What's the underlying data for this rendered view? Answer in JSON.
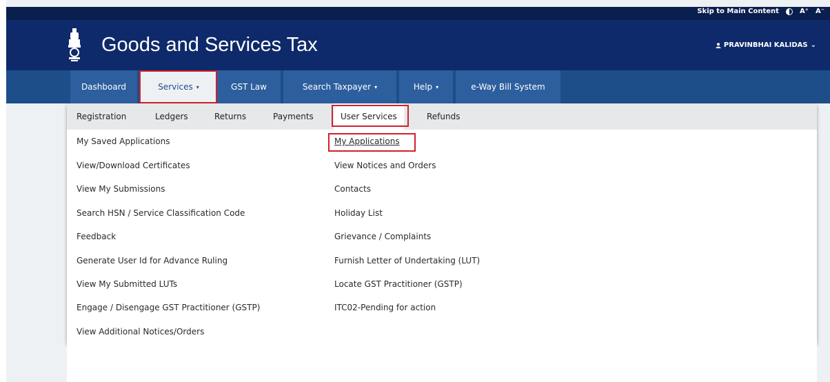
{
  "top_bar": {
    "skip_link": "Skip to Main Content",
    "font_increase": "A⁺",
    "font_decrease": "A⁻"
  },
  "header": {
    "title": "Goods and Services Tax",
    "user_name": "PRAVINBHAI KALIDAS",
    "user_caret": "⌄"
  },
  "nav": {
    "dashboard": "Dashboard",
    "services": "Services",
    "gst_law": "GST Law",
    "search_taxpayer": "Search Taxpayer",
    "help": "Help",
    "eway": "e-Way Bill System",
    "caret": "▾"
  },
  "subnav": {
    "registration": "Registration",
    "ledgers": "Ledgers",
    "returns": "Returns",
    "payments": "Payments",
    "user_services": "User Services",
    "refunds": "Refunds"
  },
  "menu": {
    "left": [
      "My Saved Applications",
      "View/Download Certificates",
      "View My Submissions",
      "Search HSN / Service Classification Code",
      "Feedback",
      "Generate User Id for Advance Ruling",
      "View My Submitted LUTs",
      "Engage / Disengage GST Practitioner (GSTP)",
      "View Additional Notices/Orders"
    ],
    "right": [
      "My Applications",
      "View Notices and Orders",
      "Contacts",
      "Holiday List",
      "Grievance / Complaints",
      "Furnish Letter of Undertaking (LUT)",
      "Locate GST Practitioner (GSTP)",
      "ITC02-Pending for action"
    ]
  },
  "colors": {
    "header": "#0f2a6b",
    "navbar": "#1d4e89",
    "highlight": "#d0202c"
  },
  "icons": {
    "emblem": "national-emblem-icon",
    "user": "user-icon",
    "contrast": "contrast-icon"
  }
}
